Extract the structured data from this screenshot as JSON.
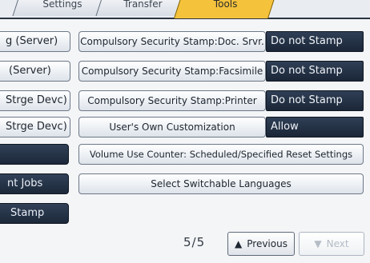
{
  "tabs": [
    {
      "label": "Settings",
      "active": false
    },
    {
      "label": "Transfer",
      "active": false
    },
    {
      "label": "Tools",
      "active": true
    }
  ],
  "left_column": [
    {
      "label": "g (Server)",
      "style": "light"
    },
    {
      "label": "(Server)",
      "style": "light"
    },
    {
      "label": "Strge Devc)",
      "style": "light"
    },
    {
      "label": "Strge Devc)",
      "style": "light"
    },
    {
      "label": "",
      "style": "dark"
    },
    {
      "label": "nt Jobs",
      "style": "dark"
    },
    {
      "label": "Stamp",
      "style": "dark"
    }
  ],
  "settings_rows": [
    {
      "label": "Compulsory Security Stamp:Doc. Srvr.",
      "value": "Do not Stamp"
    },
    {
      "label": "Compulsory Security Stamp:Facsimile",
      "value": "Do not Stamp"
    },
    {
      "label": "Compulsory Security Stamp:Printer",
      "value": "Do not Stamp"
    },
    {
      "label": "User's Own Customization",
      "value": "Allow"
    }
  ],
  "wide_rows": [
    {
      "label": "Volume Use Counter: Scheduled/Specified Reset Settings"
    },
    {
      "label": "Select Switchable Languages"
    }
  ],
  "pagination": {
    "page": "5/5",
    "previous_label": "Previous",
    "next_label": "Next",
    "previous_arrow": "▲",
    "next_arrow": "▼"
  },
  "colors": {
    "active_tab": "#f4c23b",
    "value_box": "#22304a",
    "dark_button": "#233248"
  }
}
